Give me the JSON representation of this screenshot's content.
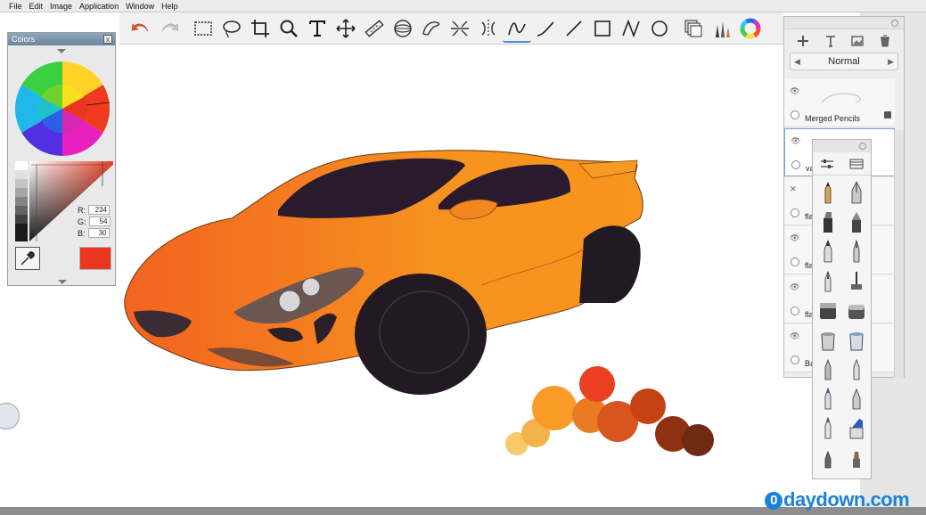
{
  "menu": [
    "File",
    "Edit",
    "Image",
    "Application",
    "Window",
    "Help"
  ],
  "toolbar": {
    "tools": [
      "undo",
      "redo",
      "rect-select",
      "lasso-select",
      "crop",
      "zoom",
      "text",
      "transform",
      "ruler",
      "ellipse-guide",
      "french-curve",
      "symmetry",
      "symmetry-mirror",
      "pencil",
      "curve",
      "line",
      "rectangle",
      "polyline",
      "ellipse",
      "layer-editor",
      "brush-palette",
      "color-wheel"
    ]
  },
  "colors_panel": {
    "title": "Colors",
    "close_label": "x",
    "rgb": [
      {
        "label": "R:",
        "value": "234"
      },
      {
        "label": "G:",
        "value": "54"
      },
      {
        "label": "B:",
        "value": "30"
      }
    ],
    "current_color": "#ea361e"
  },
  "layers_panel": {
    "blend_mode": "Normal",
    "prev_label": "◀",
    "next_label": "▶",
    "layers": [
      {
        "name": "Merged Pencils",
        "locked": true,
        "selected": false
      },
      {
        "name": "va",
        "locked": false,
        "selected": true
      },
      {
        "name": "fla",
        "locked": false,
        "selected": false
      },
      {
        "name": "fla",
        "locked": false,
        "selected": false
      },
      {
        "name": "fla",
        "locked": false,
        "selected": false
      },
      {
        "name": "Ba",
        "locked": false,
        "selected": false
      }
    ]
  },
  "watermark": {
    "badge": "0",
    "text": "daydown.com"
  },
  "palette_colors": [
    "#f7c969",
    "#f4b24a",
    "#f89b27",
    "#ec7a22",
    "#d9551f",
    "#ea3f20",
    "#c44213",
    "#8e3111",
    "#6e2a12"
  ]
}
